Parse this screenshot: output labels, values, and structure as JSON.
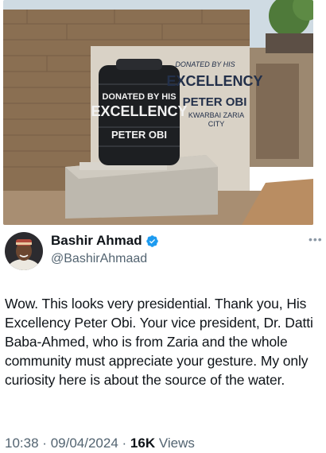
{
  "photo": {
    "tank_text": {
      "line1": "DONATED BY HIS",
      "line2": "EXCELLENCY",
      "line3": "PETER OBI"
    },
    "wall_text": {
      "line1": "DONATED BY HIS",
      "line2": "EXCELLENCY",
      "line3": "PETER OBI",
      "line4": "KWARBAI ZARIA",
      "line5": "CITY"
    }
  },
  "author": {
    "name": "Bashir Ahmad",
    "handle": "@BashirAhmaad",
    "verified_color": "#1d9bf0"
  },
  "tweet": {
    "text": "Wow. This looks very presidential. Thank you, His Excellency Peter Obi. Your vice president, Dr. Datti Baba-Ahmed, who is from Zaria and the whole community must appreciate your gesture. My only curiosity here is about the source of the water."
  },
  "meta": {
    "time": "10:38",
    "separator": "·",
    "date": "09/04/2024",
    "views_count": "16K",
    "views_label": "Views"
  },
  "icons": {
    "verified": "verified-badge-icon",
    "more": "more-options-icon"
  }
}
